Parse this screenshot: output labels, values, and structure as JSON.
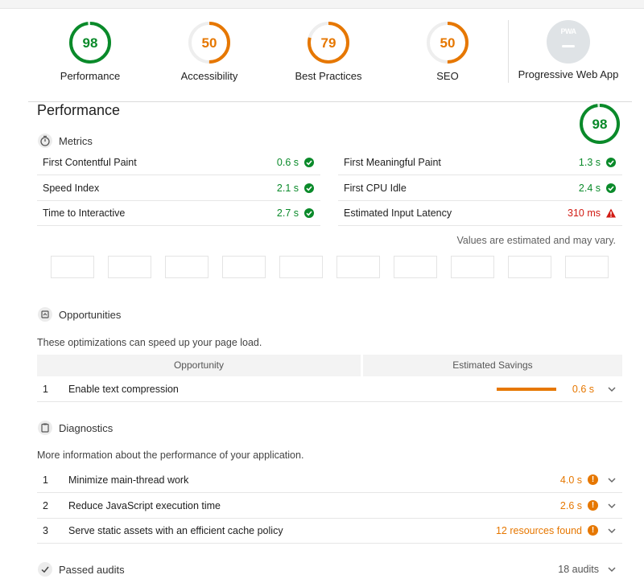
{
  "categories": [
    {
      "score": "98",
      "label": "Performance",
      "value": 98,
      "color": "#0a8a2a",
      "track": "#d9eedd"
    },
    {
      "score": "50",
      "label": "Accessibility",
      "value": 50,
      "color": "#e67700",
      "track": "#eeeeee"
    },
    {
      "score": "79",
      "label": "Best Practices",
      "value": 79,
      "color": "#e67700",
      "track": "#eeeeee"
    },
    {
      "score": "50",
      "label": "SEO",
      "value": 50,
      "color": "#e67700",
      "track": "#eeeeee"
    }
  ],
  "pwa": {
    "badge": "PWA",
    "label": "Progressive Web App"
  },
  "performance": {
    "title": "Performance",
    "score": "98",
    "value": 98,
    "color": "#0a8a2a",
    "metrics_label": "Metrics",
    "metrics": [
      {
        "name": "First Contentful Paint",
        "value": "0.6 s",
        "status": "pass"
      },
      {
        "name": "First Meaningful Paint",
        "value": "1.3 s",
        "status": "pass"
      },
      {
        "name": "Speed Index",
        "value": "2.1 s",
        "status": "pass"
      },
      {
        "name": "First CPU Idle",
        "value": "2.4 s",
        "status": "pass"
      },
      {
        "name": "Time to Interactive",
        "value": "2.7 s",
        "status": "pass"
      },
      {
        "name": "Estimated Input Latency",
        "value": "310 ms",
        "status": "fail"
      }
    ],
    "estimate_note": "Values are estimated and may vary."
  },
  "opportunities": {
    "label": "Opportunities",
    "description": "These optimizations can speed up your page load.",
    "col_opportunity": "Opportunity",
    "col_savings": "Estimated Savings",
    "items": [
      {
        "num": "1",
        "title": "Enable text compression",
        "value": "0.6 s"
      }
    ]
  },
  "diagnostics": {
    "label": "Diagnostics",
    "description": "More information about the performance of your application.",
    "items": [
      {
        "num": "1",
        "title": "Minimize main-thread work",
        "value": "4.0 s"
      },
      {
        "num": "2",
        "title": "Reduce JavaScript execution time",
        "value": "2.6 s"
      },
      {
        "num": "3",
        "title": "Serve static assets with an efficient cache policy",
        "value": "12 resources found"
      }
    ]
  },
  "passed": {
    "label": "Passed audits",
    "count": "18 audits"
  },
  "icons": {
    "metrics": "stopwatch-icon",
    "opportunities": "opportunity-icon",
    "diagnostics": "clipboard-icon",
    "passed": "checkmark-icon",
    "pass": "check-circle-icon",
    "fail": "warning-triangle-icon",
    "info": "info-icon",
    "expand": "chevron-down-icon"
  },
  "colors": {
    "pass": "#0a8a2a",
    "average": "#e67700",
    "fail": "#d11a12"
  }
}
